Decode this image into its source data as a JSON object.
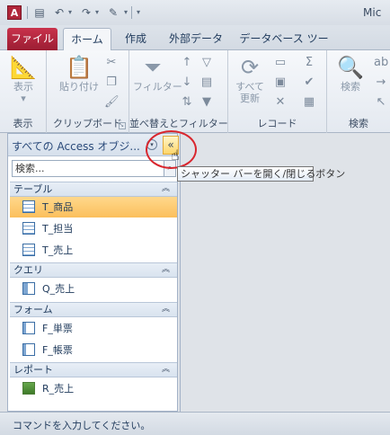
{
  "window": {
    "title": "Mic",
    "app_icon": "A"
  },
  "qat": {
    "icons": [
      "save-icon",
      "undo-icon",
      "redo-icon",
      "customize-icon"
    ]
  },
  "tabs": {
    "file": "ファイル",
    "home": "ホーム",
    "create": "作成",
    "external": "外部データ",
    "dbtools": "データベース ツール"
  },
  "ribbon": {
    "groups": {
      "view": "表示",
      "clipboard": "クリップボード",
      "sort_filter": "並べ替えとフィルター",
      "records": "レコード",
      "find": "検索"
    },
    "buttons": {
      "view": "表示",
      "paste": "貼り付け",
      "filter": "フィルター",
      "refresh_line1": "すべて",
      "refresh_line2": "更新",
      "find": "検索"
    }
  },
  "nav": {
    "title": "すべての Access オブジ...",
    "search_placeholder": "検索...",
    "categories": [
      {
        "label": "テーブル",
        "items": [
          {
            "label": "T_商品",
            "selected": true
          },
          {
            "label": "T_担当"
          },
          {
            "label": "T_売上"
          }
        ]
      },
      {
        "label": "クエリ",
        "items": [
          {
            "label": "Q_売上"
          }
        ]
      },
      {
        "label": "フォーム",
        "items": [
          {
            "label": "F_単票"
          },
          {
            "label": "F_帳票"
          }
        ]
      },
      {
        "label": "レポート",
        "items": [
          {
            "label": "R_売上"
          }
        ]
      }
    ]
  },
  "tooltip": "シャッター バーを開く/閉じるボタン",
  "status": {
    "text": "コマンドを入力してください。"
  }
}
